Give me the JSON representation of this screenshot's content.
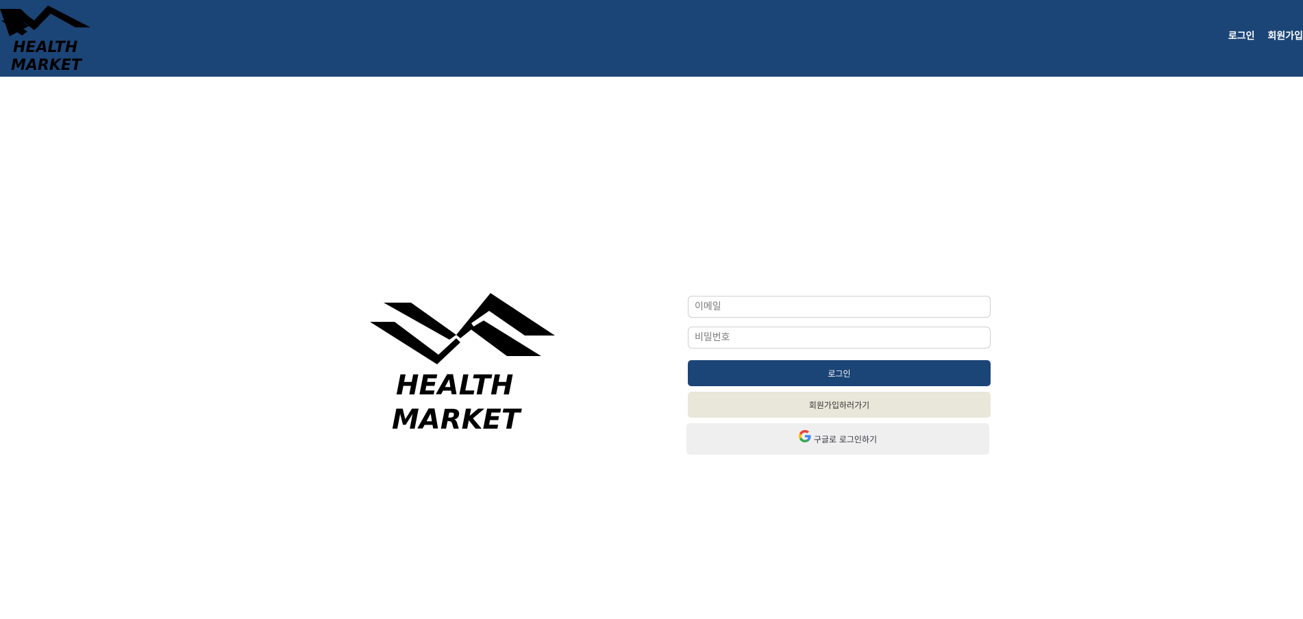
{
  "header": {
    "logo_text_line1": "HEALTH",
    "logo_text_line2": "MARKET",
    "nav": {
      "login_label": "로그인",
      "signup_label": "회원가입"
    }
  },
  "main_logo": {
    "text_line1": "HEALTH",
    "text_line2": "MARKET"
  },
  "login_form": {
    "email_placeholder": "이메일",
    "password_placeholder": "비밀번호",
    "login_button_label": "로그인",
    "signup_button_label": "회원가입하러가기",
    "google_button_label": "구글로 로그인하기",
    "google_icon": "google-g-icon"
  },
  "colors": {
    "primary": "#1c4577",
    "signup_button_bg": "#e9e6da",
    "google_button_bg": "#efefef"
  }
}
